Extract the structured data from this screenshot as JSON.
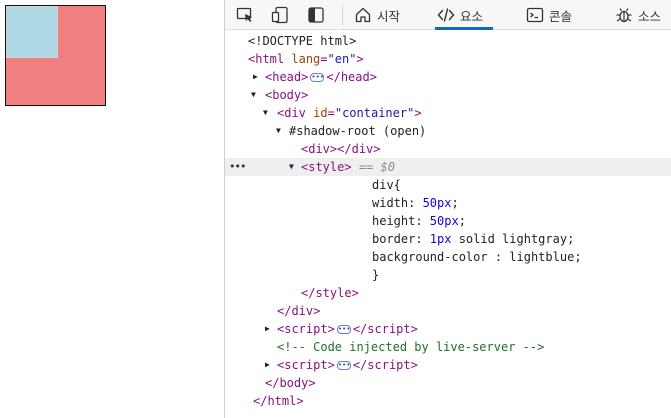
{
  "devtools": {
    "tabs": {
      "welcome": "시작",
      "elements": "요소",
      "console": "콘솔",
      "sources": "소스"
    },
    "tree": {
      "doctype": "<!DOCTYPE html>",
      "html_open": "html",
      "lang_attr": "lang",
      "lang_val": "\"en\"",
      "head": "head",
      "body": "body",
      "div": "div",
      "id_attr": "id",
      "id_val": "\"container\"",
      "shadow_root": "#shadow-root (open)",
      "inner_div": "div",
      "style": "style",
      "selected_marker": "== $0",
      "css_selector": "div{",
      "css_width_prop": "width: ",
      "css_width_val": "50px",
      "css_height_prop": "height: ",
      "css_height_val": "50px",
      "css_border_prop": "border: ",
      "css_border_val": "1px",
      "css_border_rest": " solid lightgray;",
      "css_bg_prop": "background-color : ",
      "css_bg_val": "lightblue",
      "css_close": "}",
      "script": "script",
      "comment": "<!-- Code injected by live-server -->"
    }
  },
  "colors": {
    "outer_box": "#f08080",
    "inner_box": "#add8e6",
    "accent": "#0f6cbd"
  },
  "icons": [
    "inspect-icon",
    "device-emulation-icon",
    "dock-icon",
    "home-icon",
    "code-icon",
    "console-icon",
    "bug-icon",
    "ellipsis-icon"
  ]
}
